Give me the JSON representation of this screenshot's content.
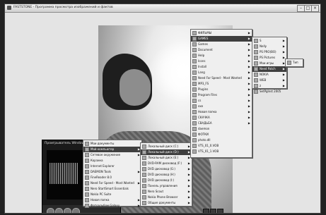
{
  "window": {
    "title": "FASTSTONE - Программа просмотра изображений и фактов"
  },
  "start_menu": {
    "items": [
      {
        "label": "Мои документы",
        "arrow": false
      },
      {
        "label": "Мой компьютер",
        "arrow": true,
        "highlight": true
      },
      {
        "label": "Сетевое окружение",
        "arrow": true
      },
      {
        "label": "Корзина",
        "arrow": false
      },
      {
        "label": "Internet Explorer",
        "arrow": false
      },
      {
        "label": "DAEMON Tools",
        "arrow": true
      },
      {
        "label": "FineReader 8.0",
        "arrow": false
      },
      {
        "label": "Need For Speed - Most Wanted",
        "arrow": true
      },
      {
        "label": "Nero StartSmart Essentials",
        "arrow": false
      },
      {
        "label": "Nokia PC Suite",
        "arrow": false
      },
      {
        "label": "Новая папка",
        "arrow": true
      },
      {
        "label": "Фотоальбом Galaxy",
        "arrow": true
      }
    ]
  },
  "drives_menu": {
    "items": [
      {
        "label": "Локальный диск (C:)",
        "arrow": true
      },
      {
        "label": "Локальный диск (D:)",
        "arrow": true,
        "highlight": true
      },
      {
        "label": "Локальный диск (E:)",
        "arrow": true
      },
      {
        "label": "DVD-RAM дисковод (F:)",
        "arrow": true
      },
      {
        "label": "DVD дисковод (G:)",
        "arrow": true
      },
      {
        "label": "DVD дисковод (H:)",
        "arrow": true
      },
      {
        "label": "DVD дисковод (I:)",
        "arrow": true
      },
      {
        "label": "Панель управления",
        "arrow": true
      },
      {
        "label": "Nero Scout",
        "arrow": true
      },
      {
        "label": "Nokia Phone Browser",
        "arrow": true
      },
      {
        "label": "Общие документы",
        "arrow": true
      }
    ]
  },
  "d_folders_menu": {
    "items": [
      {
        "label": "ФИЛЬМЫ",
        "arrow": true
      },
      {
        "label": "GAMES",
        "arrow": true,
        "highlight": true
      },
      {
        "label": "Games",
        "arrow": true
      },
      {
        "label": "Document",
        "arrow": true
      },
      {
        "label": "Help",
        "arrow": true
      },
      {
        "label": "Icons",
        "arrow": true
      },
      {
        "label": "Install",
        "arrow": true
      },
      {
        "label": "Lang",
        "arrow": true
      },
      {
        "label": "Need For Speed - Most Wanted",
        "arrow": true
      },
      {
        "label": "MP3_FS",
        "arrow": true
      },
      {
        "label": "Plugins",
        "arrow": true
      },
      {
        "label": "Program Files",
        "arrow": true
      },
      {
        "label": "cs",
        "arrow": true
      },
      {
        "label": "exe",
        "arrow": true
      },
      {
        "label": "Новая папка",
        "arrow": true
      },
      {
        "label": "СКАЧКА",
        "arrow": true
      },
      {
        "label": "СВАДЬБА",
        "arrow": true
      },
      {
        "label": "daemon",
        "arrow": false
      },
      {
        "label": "ФОТКИ",
        "arrow": false
      },
      {
        "label": "photo.dll",
        "arrow": false
      },
      {
        "label": "VTS_01_0.VOB",
        "arrow": false
      },
      {
        "label": "VTS_01_1.VOB",
        "arrow": false
      }
    ]
  },
  "games_menu": {
    "items": [
      {
        "label": "S",
        "arrow": true
      },
      {
        "label": "Nelly",
        "arrow": true
      },
      {
        "label": "PS PRO(ВО)",
        "arrow": true
      },
      {
        "label": "PS Pictures",
        "arrow": true
      },
      {
        "label": "Мои игры",
        "arrow": true
      },
      {
        "label": "Need Patch",
        "arrow": true,
        "highlight": true
      },
      {
        "label": "NOKIA",
        "arrow": true
      },
      {
        "label": "WEB",
        "arrow": true
      },
      {
        "label": "z",
        "arrow": true
      },
      {
        "label": "SetPgInst 2005",
        "arrow": false
      }
    ]
  },
  "nfs_menu": {
    "items": [
      {
        "label": "Тип",
        "arrow": false
      }
    ]
  },
  "media_player": {
    "title": "Проигрыватель Windows Media - [0:01]"
  },
  "colors": {
    "menu_bg": "#efefef",
    "highlight": "#3f3f3f"
  }
}
